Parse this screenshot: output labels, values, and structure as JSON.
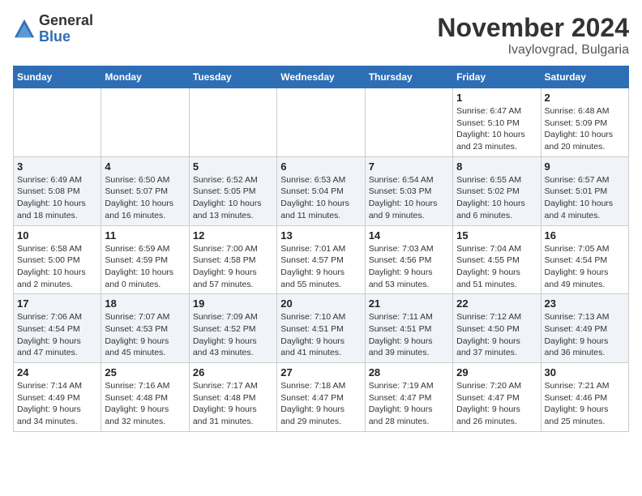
{
  "header": {
    "logo_general": "General",
    "logo_blue": "Blue",
    "month_title": "November 2024",
    "location": "Ivaylovgrad, Bulgaria"
  },
  "days_of_week": [
    "Sunday",
    "Monday",
    "Tuesday",
    "Wednesday",
    "Thursday",
    "Friday",
    "Saturday"
  ],
  "weeks": [
    {
      "days": [
        {
          "number": "",
          "info": ""
        },
        {
          "number": "",
          "info": ""
        },
        {
          "number": "",
          "info": ""
        },
        {
          "number": "",
          "info": ""
        },
        {
          "number": "",
          "info": ""
        },
        {
          "number": "1",
          "info": "Sunrise: 6:47 AM\nSunset: 5:10 PM\nDaylight: 10 hours\nand 23 minutes."
        },
        {
          "number": "2",
          "info": "Sunrise: 6:48 AM\nSunset: 5:09 PM\nDaylight: 10 hours\nand 20 minutes."
        }
      ]
    },
    {
      "days": [
        {
          "number": "3",
          "info": "Sunrise: 6:49 AM\nSunset: 5:08 PM\nDaylight: 10 hours\nand 18 minutes."
        },
        {
          "number": "4",
          "info": "Sunrise: 6:50 AM\nSunset: 5:07 PM\nDaylight: 10 hours\nand 16 minutes."
        },
        {
          "number": "5",
          "info": "Sunrise: 6:52 AM\nSunset: 5:05 PM\nDaylight: 10 hours\nand 13 minutes."
        },
        {
          "number": "6",
          "info": "Sunrise: 6:53 AM\nSunset: 5:04 PM\nDaylight: 10 hours\nand 11 minutes."
        },
        {
          "number": "7",
          "info": "Sunrise: 6:54 AM\nSunset: 5:03 PM\nDaylight: 10 hours\nand 9 minutes."
        },
        {
          "number": "8",
          "info": "Sunrise: 6:55 AM\nSunset: 5:02 PM\nDaylight: 10 hours\nand 6 minutes."
        },
        {
          "number": "9",
          "info": "Sunrise: 6:57 AM\nSunset: 5:01 PM\nDaylight: 10 hours\nand 4 minutes."
        }
      ]
    },
    {
      "days": [
        {
          "number": "10",
          "info": "Sunrise: 6:58 AM\nSunset: 5:00 PM\nDaylight: 10 hours\nand 2 minutes."
        },
        {
          "number": "11",
          "info": "Sunrise: 6:59 AM\nSunset: 4:59 PM\nDaylight: 10 hours\nand 0 minutes."
        },
        {
          "number": "12",
          "info": "Sunrise: 7:00 AM\nSunset: 4:58 PM\nDaylight: 9 hours\nand 57 minutes."
        },
        {
          "number": "13",
          "info": "Sunrise: 7:01 AM\nSunset: 4:57 PM\nDaylight: 9 hours\nand 55 minutes."
        },
        {
          "number": "14",
          "info": "Sunrise: 7:03 AM\nSunset: 4:56 PM\nDaylight: 9 hours\nand 53 minutes."
        },
        {
          "number": "15",
          "info": "Sunrise: 7:04 AM\nSunset: 4:55 PM\nDaylight: 9 hours\nand 51 minutes."
        },
        {
          "number": "16",
          "info": "Sunrise: 7:05 AM\nSunset: 4:54 PM\nDaylight: 9 hours\nand 49 minutes."
        }
      ]
    },
    {
      "days": [
        {
          "number": "17",
          "info": "Sunrise: 7:06 AM\nSunset: 4:54 PM\nDaylight: 9 hours\nand 47 minutes."
        },
        {
          "number": "18",
          "info": "Sunrise: 7:07 AM\nSunset: 4:53 PM\nDaylight: 9 hours\nand 45 minutes."
        },
        {
          "number": "19",
          "info": "Sunrise: 7:09 AM\nSunset: 4:52 PM\nDaylight: 9 hours\nand 43 minutes."
        },
        {
          "number": "20",
          "info": "Sunrise: 7:10 AM\nSunset: 4:51 PM\nDaylight: 9 hours\nand 41 minutes."
        },
        {
          "number": "21",
          "info": "Sunrise: 7:11 AM\nSunset: 4:51 PM\nDaylight: 9 hours\nand 39 minutes."
        },
        {
          "number": "22",
          "info": "Sunrise: 7:12 AM\nSunset: 4:50 PM\nDaylight: 9 hours\nand 37 minutes."
        },
        {
          "number": "23",
          "info": "Sunrise: 7:13 AM\nSunset: 4:49 PM\nDaylight: 9 hours\nand 36 minutes."
        }
      ]
    },
    {
      "days": [
        {
          "number": "24",
          "info": "Sunrise: 7:14 AM\nSunset: 4:49 PM\nDaylight: 9 hours\nand 34 minutes."
        },
        {
          "number": "25",
          "info": "Sunrise: 7:16 AM\nSunset: 4:48 PM\nDaylight: 9 hours\nand 32 minutes."
        },
        {
          "number": "26",
          "info": "Sunrise: 7:17 AM\nSunset: 4:48 PM\nDaylight: 9 hours\nand 31 minutes."
        },
        {
          "number": "27",
          "info": "Sunrise: 7:18 AM\nSunset: 4:47 PM\nDaylight: 9 hours\nand 29 minutes."
        },
        {
          "number": "28",
          "info": "Sunrise: 7:19 AM\nSunset: 4:47 PM\nDaylight: 9 hours\nand 28 minutes."
        },
        {
          "number": "29",
          "info": "Sunrise: 7:20 AM\nSunset: 4:47 PM\nDaylight: 9 hours\nand 26 minutes."
        },
        {
          "number": "30",
          "info": "Sunrise: 7:21 AM\nSunset: 4:46 PM\nDaylight: 9 hours\nand 25 minutes."
        }
      ]
    }
  ]
}
